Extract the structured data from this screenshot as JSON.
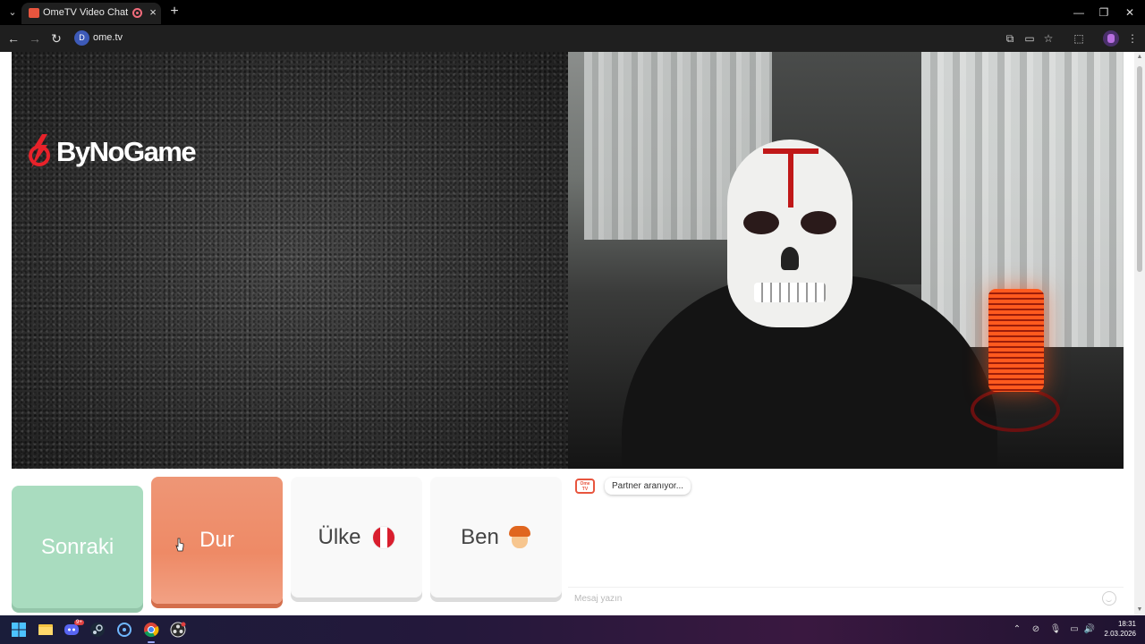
{
  "browser": {
    "tab_title": "OmeTV Video Chat — Ome",
    "tab_close": "×",
    "new_tab": "+",
    "url": "ome.tv",
    "site_badge": "D"
  },
  "window_controls": {
    "minimize": "—",
    "maximize": "❐",
    "close": "✕"
  },
  "nav": {
    "back": "←",
    "forward": "→",
    "reload": "↻"
  },
  "page": {
    "logo_text": "ByNoGame"
  },
  "controls": {
    "next_label": "Sonraki",
    "stop_label": "Dur",
    "country_label": "Ülke",
    "me_label": "Ben"
  },
  "chat": {
    "status_message": "Partner aranıyor...",
    "logo_text": "Ome TV",
    "input_placeholder": "Mesaj yazın"
  },
  "taskbar": {
    "time": "18:31",
    "date": "2.03.2026",
    "discord_badge": "9+"
  },
  "colors": {
    "next": "#a9dcbf",
    "stop": "#ee8a66",
    "accent": "#e8553e"
  }
}
